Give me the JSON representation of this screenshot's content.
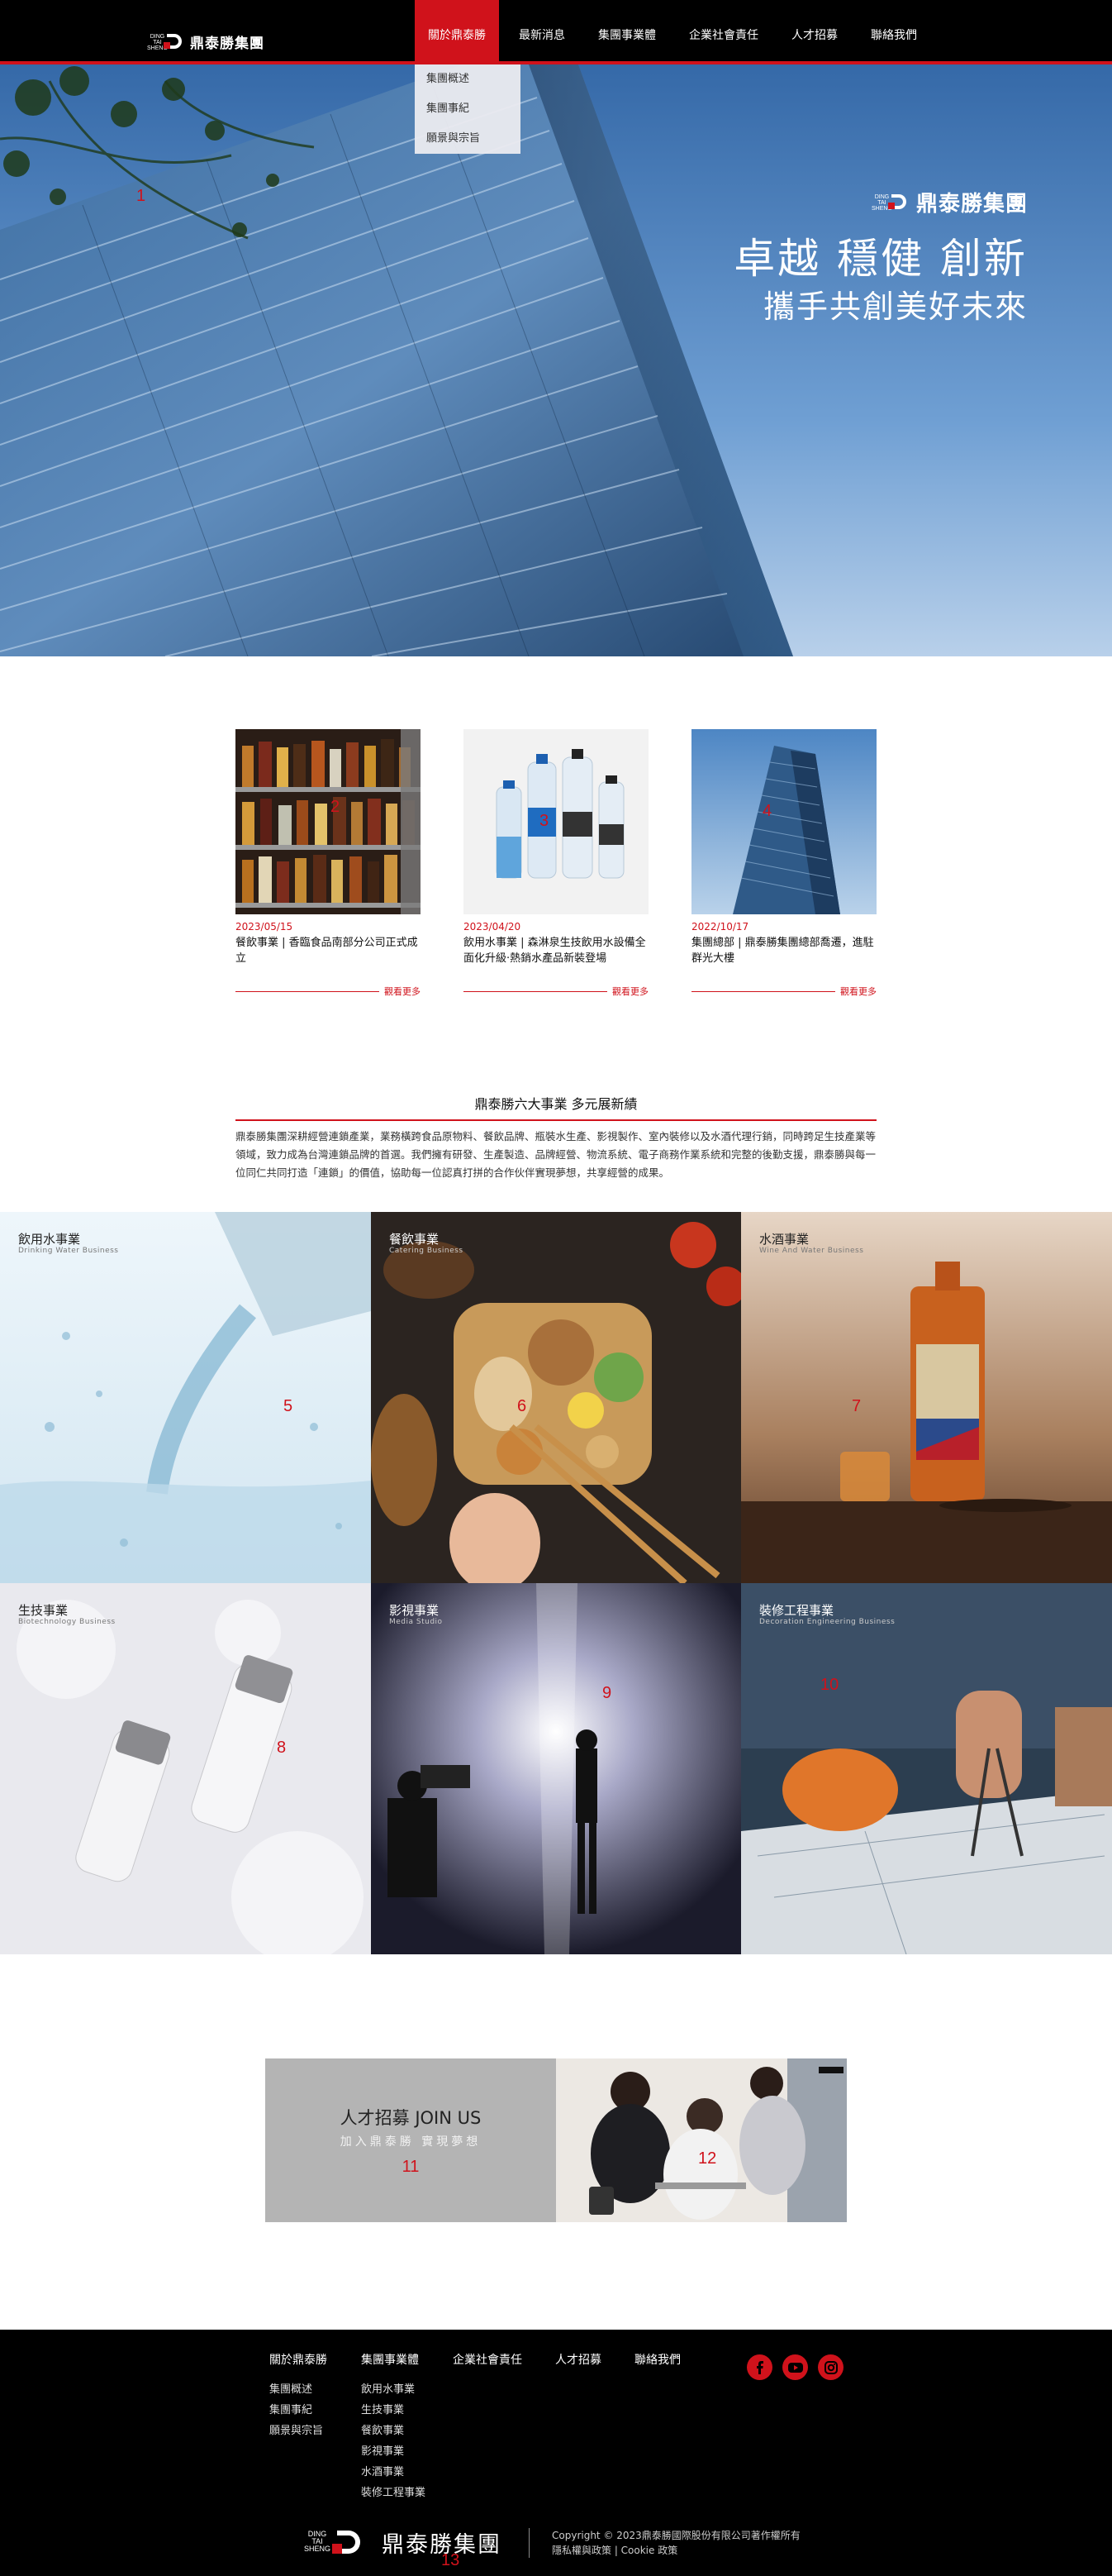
{
  "nav": {
    "brand": "鼎泰勝集團",
    "brand_small": "DING TAI SHENG",
    "items": [
      {
        "label": "關於鼎泰勝"
      },
      {
        "label": "最新消息"
      },
      {
        "label": "集團事業體"
      },
      {
        "label": "企業社會責任"
      },
      {
        "label": "人才招募"
      },
      {
        "label": "聯絡我們"
      }
    ],
    "dropdown": [
      "集團概述",
      "集團事紀",
      "願景與宗旨"
    ]
  },
  "hero": {
    "brand": "鼎泰勝集團",
    "slogan_line1": "卓越 穩健 創新",
    "slogan_line2": "攜手共創美好未來"
  },
  "news": [
    {
      "date": "2023/05/15",
      "title": "餐飲事業 | 香臨食品南部分公司正式成立",
      "more": "觀看更多"
    },
    {
      "date": "2023/04/20",
      "title": "飲用水事業 | 森淋泉生技飲用水設備全面化升級‧熱銷水產品新裝登場",
      "more": "觀看更多"
    },
    {
      "date": "2022/10/17",
      "title": "集團總部 | 鼎泰勝集團總部喬遷，進駐群光大樓",
      "more": "觀看更多"
    }
  ],
  "business": {
    "heading": "鼎泰勝六大事業 多元展新績",
    "description": "鼎泰勝集團深耕經營連鎖產業，業務橫跨食品原物料、餐飲品牌、瓶裝水生產、影視製作、室內裝修以及水酒代理行銷，同時跨足生技產業等領域，致力成為台灣連鎖品牌的首選。我們擁有研發、生產製造、品牌經營、物流系統、電子商務作業系統和完整的後勤支援，鼎泰勝與每一位同仁共同打造「連鎖」的價值，協助每一位認真打拼的合作伙伴實現夢想，共享經營的成果。",
    "tiles": [
      {
        "title": "飲用水事業",
        "sub": "Drinking Water Business"
      },
      {
        "title": "餐飲事業",
        "sub": "Catering Business"
      },
      {
        "title": "水酒事業",
        "sub": "Wine And Water Business"
      },
      {
        "title": "生技事業",
        "sub": "Biotechnology Business"
      },
      {
        "title": "影視事業",
        "sub": "Media Studio"
      },
      {
        "title": "裝修工程事業",
        "sub": "Decoration Engineering Business"
      }
    ]
  },
  "join": {
    "title": "人才招募 JOIN US",
    "subtitle": "加入鼎泰勝 實現夢想"
  },
  "footer": {
    "columns": [
      {
        "heading": "關於鼎泰勝",
        "items": [
          "集團概述",
          "集團事紀",
          "願景與宗旨"
        ]
      },
      {
        "heading": "集團事業體",
        "items": [
          "飲用水事業",
          "生技事業",
          "餐飲事業",
          "影視事業",
          "水酒事業",
          "裝修工程事業"
        ]
      },
      {
        "heading": "企業社會責任",
        "items": []
      },
      {
        "heading": "人才招募",
        "items": []
      },
      {
        "heading": "聯絡我們",
        "items": []
      }
    ],
    "social": [
      "facebook-icon",
      "youtube-icon",
      "instagram-icon"
    ],
    "brand": "鼎泰勝集團",
    "copyright": "Copyright © 2023鼎泰勝國際股份有限公司著作權所有",
    "policy": "隱私權與政策 | Cookie 政策"
  },
  "markers": [
    "1",
    "2",
    "3",
    "4",
    "5",
    "6",
    "7",
    "8",
    "9",
    "10",
    "11",
    "12",
    "13"
  ],
  "colors": {
    "accent": "#d0121b",
    "nav_bg": "#000000",
    "footer_bg": "#000000"
  }
}
